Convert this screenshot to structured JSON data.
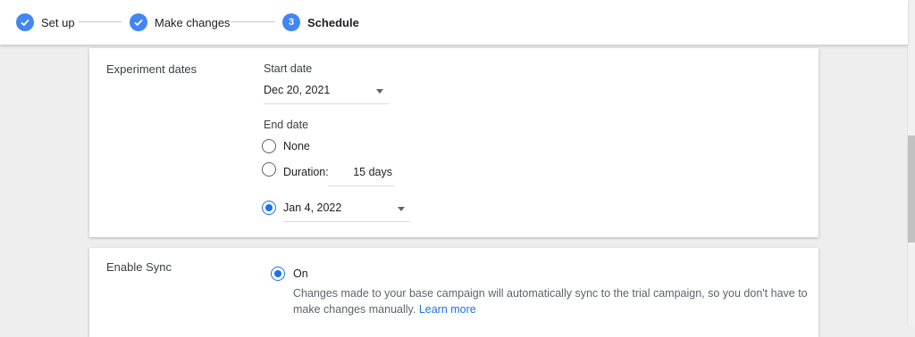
{
  "stepper": {
    "steps": [
      {
        "label": "Set up",
        "state": "done",
        "icon": "check-icon"
      },
      {
        "label": "Make changes",
        "state": "done",
        "icon": "check-icon"
      },
      {
        "label": "Schedule",
        "state": "active",
        "number": "3"
      }
    ]
  },
  "experiment_dates": {
    "section_label": "Experiment dates",
    "start_date_label": "Start date",
    "start_date_value": "Dec 20, 2021",
    "end_date_label": "End date",
    "options": {
      "none_label": "None",
      "duration_label": "Duration:",
      "duration_value": "15 days",
      "date_value": "Jan 4, 2022"
    },
    "selected": "date"
  },
  "sync": {
    "section_label": "Enable Sync",
    "on_label": "On",
    "description": "Changes made to your base campaign will automatically sync to the trial campaign, so you don't have to make changes manually.",
    "learn_more": "Learn more"
  },
  "colors": {
    "accent": "#1a73e8",
    "step": "#4285f4",
    "background": "#eeeeee"
  }
}
